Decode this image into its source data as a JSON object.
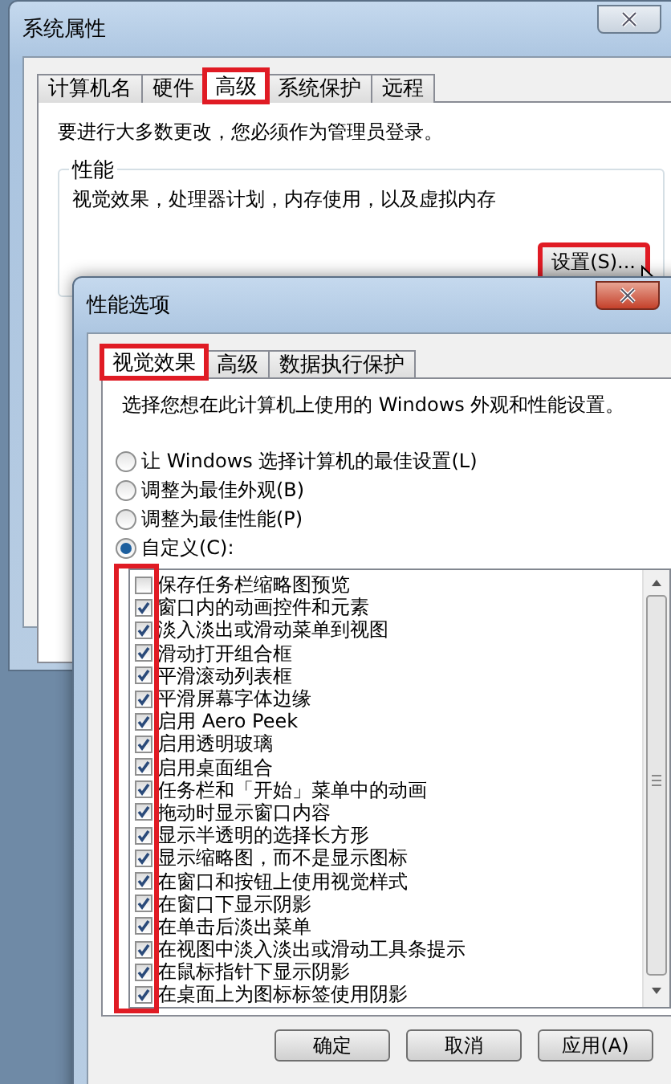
{
  "back_window": {
    "title": "系统属性",
    "tabs": [
      {
        "label": "计算机名",
        "selected": false,
        "highlighted": false
      },
      {
        "label": "硬件",
        "selected": false,
        "highlighted": false
      },
      {
        "label": "高级",
        "selected": true,
        "highlighted": true
      },
      {
        "label": "系统保护",
        "selected": false,
        "highlighted": false
      },
      {
        "label": "远程",
        "selected": false,
        "highlighted": false
      }
    ],
    "notice": "要进行大多数更改，您必须作为管理员登录。",
    "group": {
      "title": "性能",
      "description": "视觉效果，处理器计划，内存使用，以及虚拟内存",
      "button": {
        "label": "设置(S)...",
        "highlighted": true
      }
    }
  },
  "dialog": {
    "title": "性能选项",
    "tabs": [
      {
        "label": "视觉效果",
        "selected": true,
        "highlighted": true
      },
      {
        "label": "高级",
        "selected": false,
        "highlighted": false
      },
      {
        "label": "数据执行保护",
        "selected": false,
        "highlighted": false
      }
    ],
    "intro": "选择您想在此计算机上使用的 Windows 外观和性能设置。",
    "options": [
      {
        "label": "让 Windows 选择计算机的最佳设置(L)",
        "selected": false
      },
      {
        "label": "调整为最佳外观(B)",
        "selected": false
      },
      {
        "label": "调整为最佳性能(P)",
        "selected": false
      },
      {
        "label": "自定义(C):",
        "selected": true
      }
    ],
    "checks_highlighted": true,
    "effects": [
      {
        "label": "保存任务栏缩略图预览",
        "checked": false
      },
      {
        "label": "窗口内的动画控件和元素",
        "checked": true
      },
      {
        "label": "淡入淡出或滑动菜单到视图",
        "checked": true
      },
      {
        "label": "滑动打开组合框",
        "checked": true
      },
      {
        "label": "平滑滚动列表框",
        "checked": true
      },
      {
        "label": "平滑屏幕字体边缘",
        "checked": true
      },
      {
        "label": "启用 Aero Peek",
        "checked": true
      },
      {
        "label": "启用透明玻璃",
        "checked": true
      },
      {
        "label": "启用桌面组合",
        "checked": true
      },
      {
        "label": "任务栏和「开始」菜单中的动画",
        "checked": true
      },
      {
        "label": "拖动时显示窗口内容",
        "checked": true
      },
      {
        "label": "显示半透明的选择长方形",
        "checked": true
      },
      {
        "label": "显示缩略图，而不是显示图标",
        "checked": true
      },
      {
        "label": "在窗口和按钮上使用视觉样式",
        "checked": true
      },
      {
        "label": "在窗口下显示阴影",
        "checked": true
      },
      {
        "label": "在单击后淡出菜单",
        "checked": true
      },
      {
        "label": "在视图中淡入淡出或滑动工具条提示",
        "checked": true
      },
      {
        "label": "在鼠标指针下显示阴影",
        "checked": true
      },
      {
        "label": "在桌面上为图标标签使用阴影",
        "checked": true
      }
    ],
    "buttons": [
      "确定",
      "取消",
      "应用(A)"
    ]
  }
}
